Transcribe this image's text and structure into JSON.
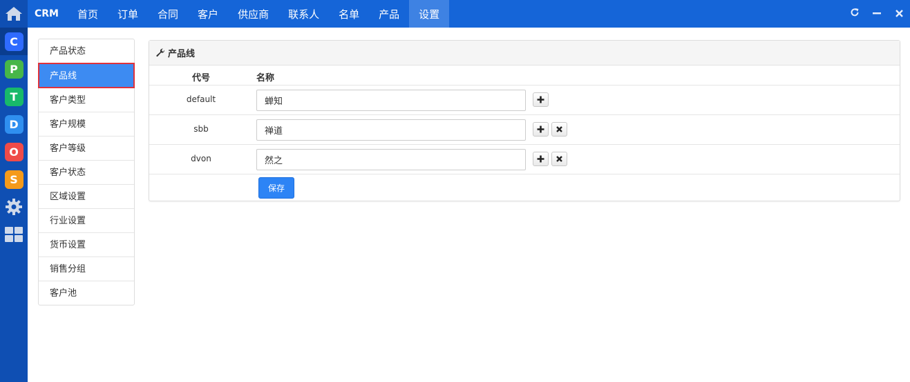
{
  "app": {
    "brand": "CRM"
  },
  "dock": {
    "apps": [
      {
        "letter": "C",
        "color": "#2f6bff",
        "active": true
      },
      {
        "letter": "P",
        "color": "#47b649",
        "active": false
      },
      {
        "letter": "T",
        "color": "#18b96a",
        "active": false
      },
      {
        "letter": "D",
        "color": "#2f8ff0",
        "active": false
      },
      {
        "letter": "O",
        "color": "#ef4b49",
        "active": false
      },
      {
        "letter": "S",
        "color": "#f59a1a",
        "active": false
      }
    ]
  },
  "nav": {
    "items": [
      "首页",
      "订单",
      "合同",
      "客户",
      "供应商",
      "联系人",
      "名单",
      "产品",
      "设置"
    ],
    "active_index": 8
  },
  "side_menu": {
    "items": [
      "产品状态",
      "产品线",
      "客户类型",
      "客户规模",
      "客户等级",
      "客户状态",
      "区域设置",
      "行业设置",
      "货币设置",
      "销售分组",
      "客户池"
    ],
    "active_index": 1
  },
  "panel": {
    "title": "产品线",
    "columns": {
      "code": "代号",
      "name": "名称"
    },
    "rows": [
      {
        "code": "default",
        "name": "蝉知",
        "deletable": false
      },
      {
        "code": "sbb",
        "name": "禅道",
        "deletable": true
      },
      {
        "code": "dvon",
        "name": "然之",
        "deletable": true
      }
    ],
    "save_label": "保存"
  },
  "colors": {
    "topbar": "#1565d8",
    "dock": "#0f4fb3",
    "accent": "#2d84f5",
    "highlight_border": "#e0323b"
  }
}
